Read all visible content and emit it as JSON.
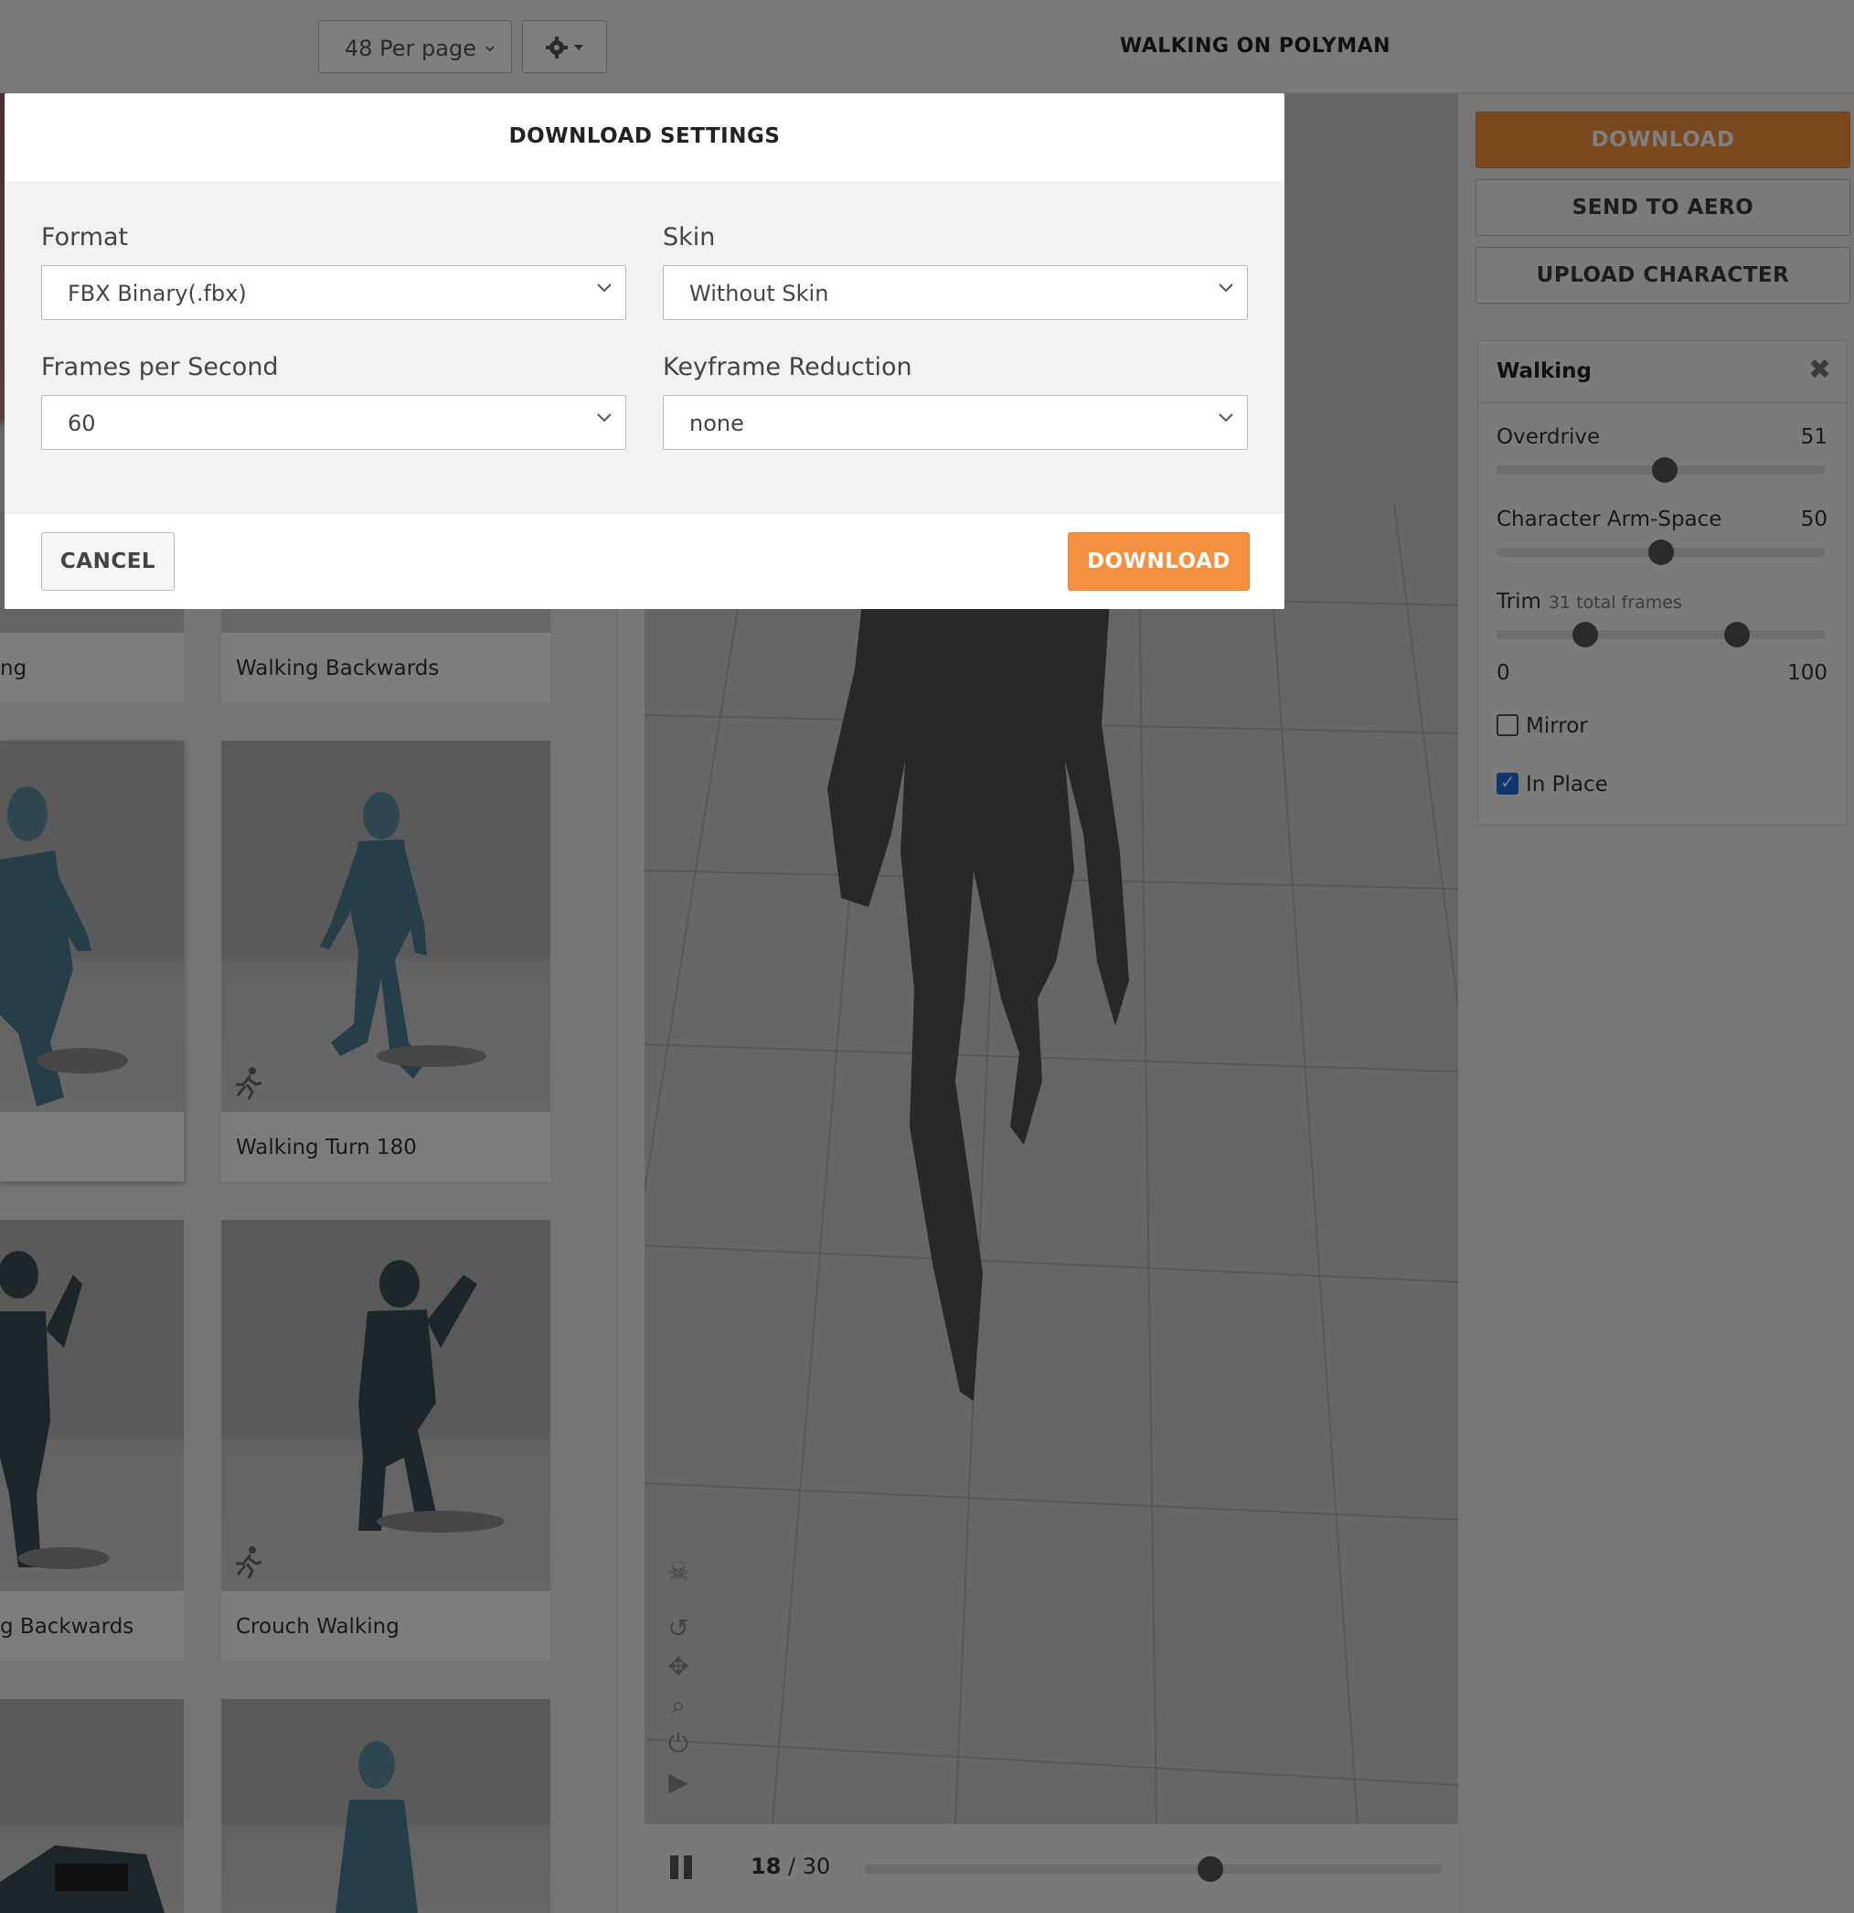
{
  "toolbar": {
    "per_page": "48 Per page",
    "settings_icon": "gear-icon"
  },
  "viewer": {
    "title": "WALKING ON POLYMAN",
    "current_frame": "18",
    "frame_sep": " / ",
    "total_frames": "30",
    "progress": 0.6,
    "tools": [
      "skull-icon",
      "rotate-icon",
      "move-icon",
      "zoom-icon",
      "power-icon",
      "camera-icon"
    ]
  },
  "cards": [
    {
      "label": "ng"
    },
    {
      "label": "Walking Backwards"
    },
    {
      "label": ""
    },
    {
      "label": "Walking Turn 180"
    },
    {
      "label": "g Backwards"
    },
    {
      "label": "Crouch Walking"
    }
  ],
  "right": {
    "download": "DOWNLOAD",
    "send_to_aero": "SEND TO AERO",
    "upload_character": "UPLOAD CHARACTER",
    "panel_title": "Walking",
    "overdrive_label": "Overdrive",
    "overdrive_value": "51",
    "overdrive_pct": 51,
    "armspace_label": "Character Arm-Space",
    "armspace_value": "50",
    "armspace_pct": 50,
    "trim_label": "Trim",
    "trim_sub": "31 total frames",
    "trim_low_pct": 27,
    "trim_high_pct": 73,
    "trim_min": "0",
    "trim_max": "100",
    "mirror_label": "Mirror",
    "mirror_checked": false,
    "inplace_label": "In Place",
    "inplace_checked": true
  },
  "modal": {
    "title": "DOWNLOAD SETTINGS",
    "format_label": "Format",
    "format_value": "FBX Binary(.fbx)",
    "skin_label": "Skin",
    "skin_value": "Without Skin",
    "fps_label": "Frames per Second",
    "fps_value": "60",
    "keyframe_label": "Keyframe Reduction",
    "keyframe_value": "none",
    "cancel": "CANCEL",
    "download": "DOWNLOAD"
  },
  "colors": {
    "accent": "#f5913e",
    "checkbox": "#1d6fe0"
  }
}
